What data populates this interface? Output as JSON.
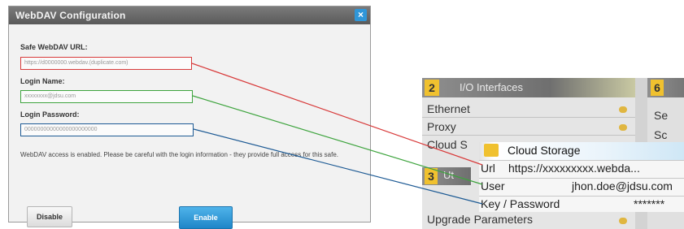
{
  "dialog": {
    "title": "WebDAV Configuration",
    "close_label": "×",
    "url_label": "Safe WebDAV URL:",
    "url_value": "https://d0000000.webdav.(duplicate.com)",
    "login_label": "Login Name:",
    "login_value": "xxxxxxxx@jdsu.com",
    "password_label": "Login Password:",
    "password_value": "00000000000000000000000",
    "note": "WebDAV access is enabled. Please be careful with the login information - they provide full access for this safe.",
    "disable_label": "Disable",
    "enable_label": "Enable"
  },
  "device": {
    "io_panel": {
      "number": "2",
      "title": "I/O Interfaces",
      "items": [
        "Ethernet",
        "Proxy",
        "Cloud S"
      ]
    },
    "panel_6": {
      "number": "6",
      "text1": "Se",
      "text2": "Sc"
    },
    "panel_3": {
      "number": "3",
      "text": "Ut"
    },
    "cloud_popup": {
      "title": "Cloud Storage",
      "rows": [
        {
          "key": "Url",
          "value": "https://xxxxxxxxx.webda..."
        },
        {
          "key": "User",
          "value": "jhon.doe@jdsu.com"
        },
        {
          "key": "Key / Password",
          "value": "*******"
        }
      ]
    },
    "bottom_item": "Upgrade Parameters"
  },
  "colors": {
    "url_highlight": "#d83a3a",
    "login_highlight": "#3ea43e",
    "password_highlight": "#1d5a94",
    "accent": "#2f96d8"
  }
}
